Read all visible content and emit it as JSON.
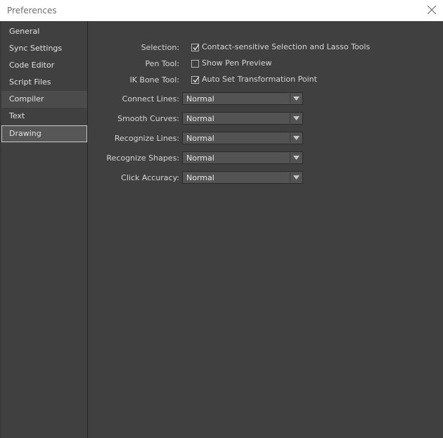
{
  "window": {
    "title": "Preferences"
  },
  "sidebar": {
    "items": [
      {
        "label": "General"
      },
      {
        "label": "Sync Settings"
      },
      {
        "label": "Code Editor"
      },
      {
        "label": "Script Files"
      },
      {
        "label": "Compiler"
      },
      {
        "label": "Text"
      },
      {
        "label": "Drawing"
      }
    ],
    "selected": "Drawing"
  },
  "drawing": {
    "selection": {
      "label": "Selection:",
      "checkbox_label": "Contact-sensitive Selection and Lasso Tools",
      "checked": true
    },
    "pen_tool": {
      "label": "Pen Tool:",
      "checkbox_label": "Show Pen Preview",
      "checked": false
    },
    "ik_bone_tool": {
      "label": "IK Bone Tool:",
      "checkbox_label": "Auto Set Transformation Point",
      "checked": true
    },
    "connect_lines": {
      "label": "Connect Lines:",
      "value": "Normal"
    },
    "smooth_curves": {
      "label": "Smooth Curves:",
      "value": "Normal"
    },
    "recognize_lines": {
      "label": "Recognize Lines:",
      "value": "Normal"
    },
    "recognize_shapes": {
      "label": "Recognize Shapes:",
      "value": "Normal"
    },
    "click_accuracy": {
      "label": "Click Accuracy:",
      "value": "Normal"
    }
  },
  "colors": {
    "background": "#404040",
    "titlebar": "#ffffff",
    "text": "#d6d6d6",
    "selected_item": "#575757"
  }
}
